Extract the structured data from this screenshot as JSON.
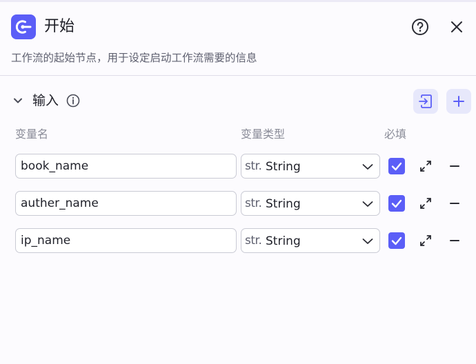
{
  "header": {
    "title": "开始",
    "icon": "start-node-icon",
    "accent_color": "#5b5ef7"
  },
  "description": "工作流的起始节点，用于设定启动工作流需要的信息",
  "inputs": {
    "section_title": "输入",
    "columns": {
      "name": "变量名",
      "type": "变量类型",
      "required": "必填"
    },
    "rows": [
      {
        "name": "book_name",
        "type_prefix": "str.",
        "type": "String",
        "required": true
      },
      {
        "name": "auther_name",
        "type_prefix": "str.",
        "type": "String",
        "required": true
      },
      {
        "name": "ip_name",
        "type_prefix": "str.",
        "type": "String",
        "required": true
      }
    ]
  }
}
